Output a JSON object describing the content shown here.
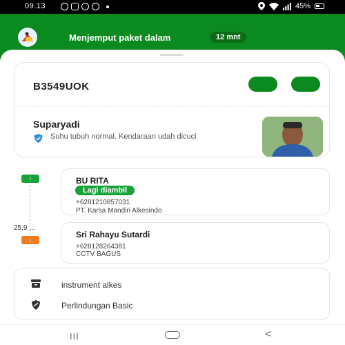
{
  "status_bar": {
    "time": "09.13",
    "battery": "45%"
  },
  "header": {
    "title": "Menjemput paket dalam",
    "eta": "12 mnt"
  },
  "driver": {
    "plate": "B3549UOK",
    "name": "Suparyadi",
    "health_note": "Suhu tubuh normal. Kendaraan udah dicuci"
  },
  "route": {
    "distance": "25,9 ...",
    "pickup": {
      "name": "BU RITA",
      "status": "Lagi diambil",
      "phone": "+6281210857031",
      "note": "PT. Karsa Mandiri Alkesindo"
    },
    "dropoff": {
      "name": "Sri Rahayu Sutardi",
      "phone": "+628128264381",
      "note": "CCTV BAGUS"
    }
  },
  "items": [
    {
      "label": "instrument alkes",
      "icon": "box-icon"
    },
    {
      "label": "Perlindungan Basic",
      "icon": "protection-shield-icon"
    }
  ],
  "colors": {
    "brand": "#0a8a1f",
    "pickup": "#18a23a",
    "dropoff": "#f07b1c"
  }
}
